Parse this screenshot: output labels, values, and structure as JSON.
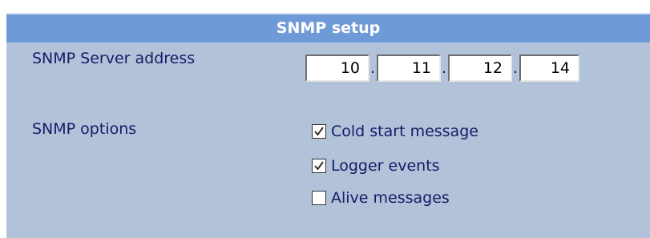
{
  "panel": {
    "title": "SNMP setup"
  },
  "server": {
    "label": "SNMP Server address",
    "octets": [
      "10",
      "11",
      "12",
      "14"
    ],
    "separator": "."
  },
  "options": {
    "label": "SNMP options",
    "items": [
      {
        "label": "Cold start message",
        "checked": true
      },
      {
        "label": "Logger events",
        "checked": true
      },
      {
        "label": "Alive messages",
        "checked": false
      }
    ]
  },
  "colors": {
    "header_bg": "#6f9ad8",
    "panel_bg": "#b1c2d9",
    "label_text": "#1a1a66"
  }
}
